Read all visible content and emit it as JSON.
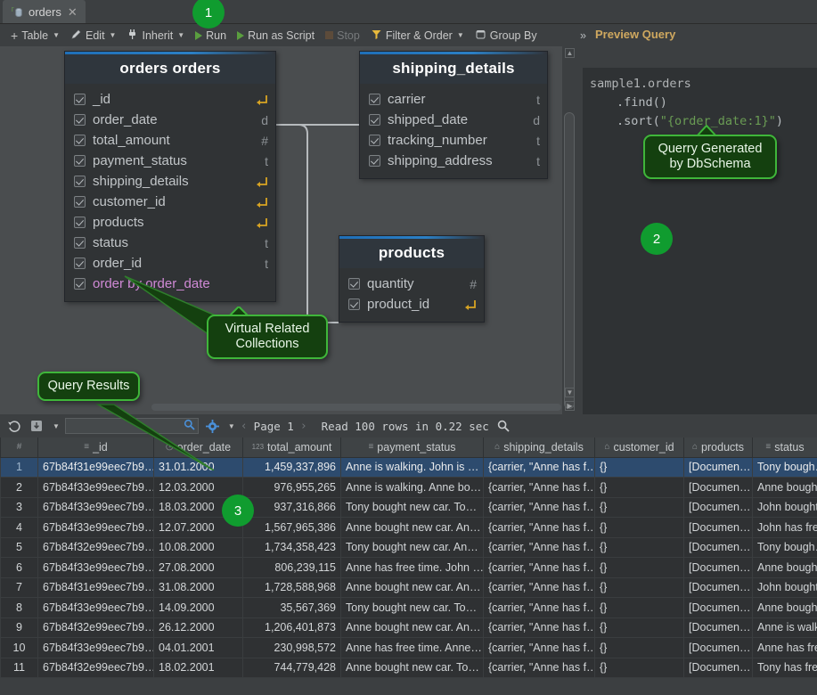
{
  "tab": {
    "label": "orders",
    "close": "✕",
    "icon": "collection-icon"
  },
  "toolbar": {
    "items": [
      {
        "label": "Table",
        "icon": "plus-icon",
        "caret": true,
        "disabled": false
      },
      {
        "label": "Edit",
        "icon": "pencil-icon",
        "caret": true,
        "disabled": false
      },
      {
        "label": "Inherit",
        "icon": "plug-icon",
        "caret": true,
        "disabled": false
      },
      {
        "label": "Run",
        "icon": "play-icon",
        "caret": false,
        "disabled": false
      },
      {
        "label": "Run as Script",
        "icon": "play-icon",
        "caret": false,
        "disabled": false
      },
      {
        "label": "Stop",
        "icon": "stop-icon",
        "caret": false,
        "disabled": true
      },
      {
        "label": "Filter & Order",
        "icon": "funnel-icon",
        "caret": true,
        "disabled": false
      },
      {
        "label": "Group By",
        "icon": "group-icon",
        "caret": false,
        "disabled": false
      }
    ],
    "expand": "»"
  },
  "diagram": {
    "entities": [
      {
        "title": "orders orders",
        "columns": [
          {
            "name": "_id",
            "type": "",
            "fk": true,
            "virtual": false
          },
          {
            "name": "order_date",
            "type": "d",
            "fk": false,
            "virtual": false
          },
          {
            "name": "total_amount",
            "type": "#",
            "fk": false,
            "virtual": false
          },
          {
            "name": "payment_status",
            "type": "t",
            "fk": false,
            "virtual": false
          },
          {
            "name": "shipping_details",
            "type": "",
            "fk": true,
            "virtual": false
          },
          {
            "name": "customer_id",
            "type": "",
            "fk": true,
            "virtual": false
          },
          {
            "name": "products",
            "type": "",
            "fk": true,
            "virtual": false
          },
          {
            "name": "status",
            "type": "t",
            "fk": false,
            "virtual": false
          },
          {
            "name": "order_id",
            "type": "t",
            "fk": false,
            "virtual": false
          },
          {
            "name": "order by order_date",
            "type": "",
            "fk": false,
            "virtual": true
          }
        ]
      },
      {
        "title": "shipping_details",
        "columns": [
          {
            "name": "carrier",
            "type": "t",
            "fk": false,
            "virtual": false
          },
          {
            "name": "shipped_date",
            "type": "d",
            "fk": false,
            "virtual": false
          },
          {
            "name": "tracking_number",
            "type": "t",
            "fk": false,
            "virtual": false
          },
          {
            "name": "shipping_address",
            "type": "t",
            "fk": false,
            "virtual": false
          }
        ]
      },
      {
        "title": "products",
        "columns": [
          {
            "name": "quantity",
            "type": "#",
            "fk": false,
            "virtual": false
          },
          {
            "name": "product_id",
            "type": "",
            "fk": true,
            "virtual": false
          }
        ]
      }
    ]
  },
  "preview": {
    "title": "Preview Query",
    "line1": "sample1.orders",
    "line2": ".find()",
    "line3_fn": ".sort(",
    "line3_str": "\"{order_date:1}\"",
    "line3_end": ")"
  },
  "callouts": {
    "virtual": "Virtual Related\nCollections",
    "query_generated": "Querry Generated\nby DbSchema",
    "query_results": "Query Results"
  },
  "badges": [
    "1",
    "2",
    "3"
  ],
  "results": {
    "page_label": "Page 1",
    "read_info": "Read 100 rows in 0.22 sec",
    "search_placeholder": "",
    "search_value": "",
    "columns": [
      {
        "label": "#",
        "icon": "hash-icon"
      },
      {
        "label": "_id",
        "icon": "text-icon"
      },
      {
        "label": "order_date",
        "icon": "clock-icon"
      },
      {
        "label": "total_amount",
        "icon": "number-icon"
      },
      {
        "label": "payment_status",
        "icon": "text-icon"
      },
      {
        "label": "shipping_details",
        "icon": "object-icon"
      },
      {
        "label": "customer_id",
        "icon": "object-icon"
      },
      {
        "label": "products",
        "icon": "object-icon"
      },
      {
        "label": "status",
        "icon": "text-icon"
      }
    ],
    "rows": [
      {
        "n": "1",
        "id": "67b84f31e99eec7b9…",
        "date": "31.01.2000",
        "amount": "1,459,337,896",
        "payment": "Anne is walking. John is …",
        "shipping": "{carrier, \"Anne has f…",
        "customer": "{}",
        "products": "[Documen…",
        "status": "Tony bough…",
        "selected": true
      },
      {
        "n": "2",
        "id": "67b84f33e99eec7b9…",
        "date": "12.03.2000",
        "amount": "976,955,265",
        "payment": "Anne is walking. Anne bo…",
        "shipping": "{carrier, \"Anne has f…",
        "customer": "{}",
        "products": "[Documen…",
        "status": "Anne bough…",
        "selected": false
      },
      {
        "n": "3",
        "id": "67b84f33e99eec7b9…",
        "date": "18.03.2000",
        "amount": "937,316,866",
        "payment": "Tony bought new car. To…",
        "shipping": "{carrier, \"Anne has f…",
        "customer": "{}",
        "products": "[Documen…",
        "status": "John bought…",
        "selected": false
      },
      {
        "n": "4",
        "id": "67b84f33e99eec7b9…",
        "date": "12.07.2000",
        "amount": "1,567,965,386",
        "payment": "Anne bought new car. An…",
        "shipping": "{carrier, \"Anne has f…",
        "customer": "{}",
        "products": "[Documen…",
        "status": "John has fre…",
        "selected": false
      },
      {
        "n": "5",
        "id": "67b84f32e99eec7b9…",
        "date": "10.08.2000",
        "amount": "1,734,358,423",
        "payment": "Tony bought new car. An…",
        "shipping": "{carrier, \"Anne has f…",
        "customer": "{}",
        "products": "[Documen…",
        "status": "Tony bough…",
        "selected": false
      },
      {
        "n": "6",
        "id": "67b84f33e99eec7b9…",
        "date": "27.08.2000",
        "amount": "806,239,115",
        "payment": "Anne has free time. John …",
        "shipping": "{carrier, \"Anne has f…",
        "customer": "{}",
        "products": "[Documen…",
        "status": "Anne bough…",
        "selected": false
      },
      {
        "n": "7",
        "id": "67b84f31e99eec7b9…",
        "date": "31.08.2000",
        "amount": "1,728,588,968",
        "payment": "Anne bought new car. An…",
        "shipping": "{carrier, \"Anne has f…",
        "customer": "{}",
        "products": "[Documen…",
        "status": "John bought…",
        "selected": false
      },
      {
        "n": "8",
        "id": "67b84f33e99eec7b9…",
        "date": "14.09.2000",
        "amount": "35,567,369",
        "payment": "Tony bought new car. To…",
        "shipping": "{carrier, \"Anne has f…",
        "customer": "{}",
        "products": "[Documen…",
        "status": "Anne bough…",
        "selected": false
      },
      {
        "n": "9",
        "id": "67b84f32e99eec7b9…",
        "date": "26.12.2000",
        "amount": "1,206,401,873",
        "payment": "Anne bought new car. An…",
        "shipping": "{carrier, \"Anne has f…",
        "customer": "{}",
        "products": "[Documen…",
        "status": "Anne is walk…",
        "selected": false
      },
      {
        "n": "10",
        "id": "67b84f33e99eec7b9…",
        "date": "04.01.2001",
        "amount": "230,998,572",
        "payment": "Anne has free time. Anne…",
        "shipping": "{carrier, \"Anne has f…",
        "customer": "{}",
        "products": "[Documen…",
        "status": "Anne has fre…",
        "selected": false
      },
      {
        "n": "11",
        "id": "67b84f32e99eec7b9…",
        "date": "18.02.2001",
        "amount": "744,779,428",
        "payment": "Anne bought new car. To…",
        "shipping": "{carrier, \"Anne has f…",
        "customer": "{}",
        "products": "[Documen…",
        "status": "Tony has fre…",
        "selected": false
      }
    ]
  },
  "colors": {
    "accent_green": "#109c2f",
    "callout_border": "#3fb63a",
    "callout_fill": "#14400f",
    "selection": "#2d4b6e",
    "virtual_col": "#d08ad6",
    "preview_title": "#cfa85f",
    "string_green": "#6a9c54"
  }
}
